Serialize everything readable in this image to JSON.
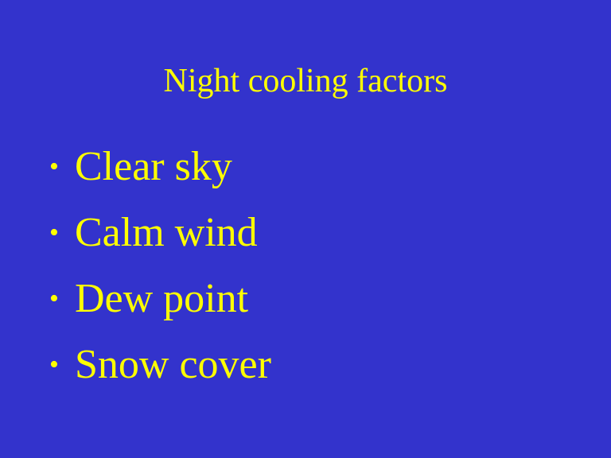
{
  "slide": {
    "background_color": "#3333cc",
    "text_color": "#ffff00",
    "title": "Night cooling factors",
    "bullet_symbol": "•",
    "bullets": [
      {
        "text": "Clear sky"
      },
      {
        "text": "Calm wind"
      },
      {
        "text": "Dew point"
      },
      {
        "text": "Snow cover"
      }
    ]
  }
}
